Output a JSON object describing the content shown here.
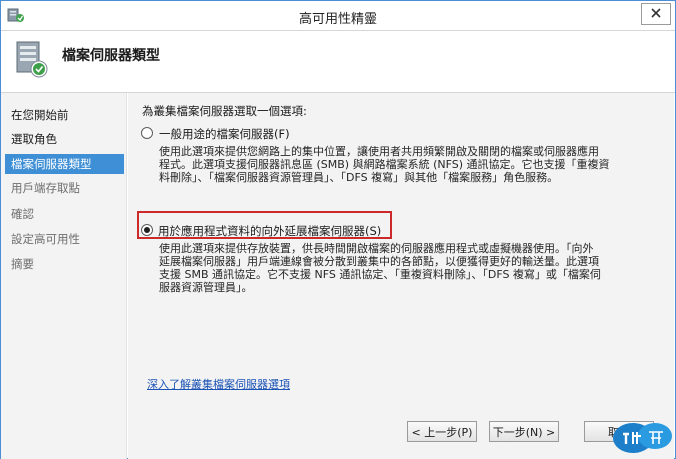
{
  "window": {
    "title": "高可用性精靈"
  },
  "header": {
    "title": "檔案伺服器類型"
  },
  "sidebar": {
    "items": [
      {
        "label": "在您開始前",
        "state": "normal"
      },
      {
        "label": "選取角色",
        "state": "normal"
      },
      {
        "label": "檔案伺服器類型",
        "state": "active"
      },
      {
        "label": "用戶端存取點",
        "state": "disabled"
      },
      {
        "label": "確認",
        "state": "disabled"
      },
      {
        "label": "設定高可用性",
        "state": "disabled"
      },
      {
        "label": "摘要",
        "state": "disabled"
      }
    ]
  },
  "main": {
    "prompt": "為叢集檔案伺服器選取一個選項:",
    "options": [
      {
        "label": "一般用途的檔案伺服器(F)",
        "selected": false,
        "description_lines": [
          "使用此選項來提供您網路上的集中位置，讓使用者共用頻繁開啟及關閉的檔案或伺服器應用",
          "程式。此選項支援伺服器訊息區 (SMB) 與網路檔案系統 (NFS) 通訊協定。它也支援「重複資",
          "料刪除」、「檔案伺服器資源管理員」、「DFS 複寫」與其他「檔案服務」角色服務。"
        ]
      },
      {
        "label": "用於應用程式資料的向外延展檔案伺服器(S)",
        "selected": true,
        "description_lines": [
          "使用此選項來提供存放裝置，供長時間開啟檔案的伺服器應用程式或虛擬機器使用。「向外",
          "延展檔案伺服器」用戶端連線會被分散到叢集中的各節點，以便獲得更好的輸送量。此選項",
          "支援 SMB 通訊協定。它不支援 NFS 通訊協定、「重複資料刪除」、「DFS 複寫」或「檔案伺",
          "服器資源管理員」。"
        ]
      }
    ],
    "learn_more_link": "深入了解叢集檔案伺服器選項"
  },
  "buttons": {
    "previous": "< 上一步(P)",
    "next": "下一步(N) >",
    "cancel": "取消"
  },
  "colors": {
    "accent": "#3f8fd6",
    "highlight_border": "#cc2a2a",
    "link": "#1a52b5"
  }
}
